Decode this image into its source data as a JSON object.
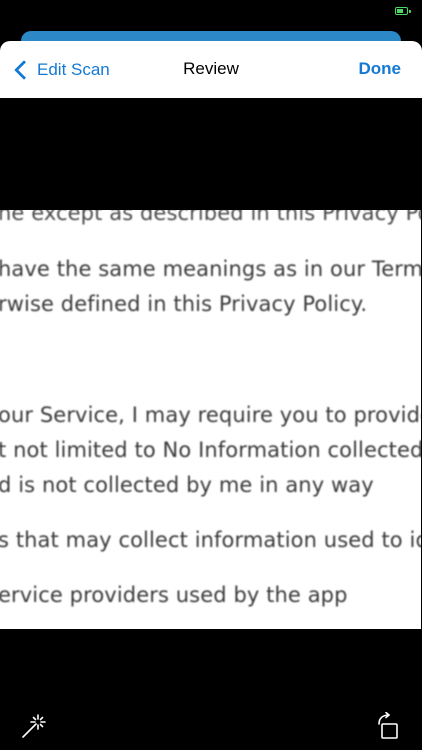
{
  "status_bar": {
    "battery_level": 0.7,
    "battery_color": "#4cd964"
  },
  "nav": {
    "back_label": "Edit Scan",
    "title": "Review",
    "done_label": "Done",
    "accent_color": "#1479d4"
  },
  "scan": {
    "lines": [
      "ne except as described in this Privacy Pol",
      "have the same meanings as in our Terms",
      "rwise defined in this Privacy Policy.",
      "our Service, I may require you to provide",
      "t not limited to No Information collected",
      "d is not collected by me in any way",
      "s that may collect information used to ide",
      "ervice providers used by the app"
    ]
  },
  "toolbar": {
    "left_icon": "magic-wand-icon",
    "right_icon": "rotate-icon"
  }
}
